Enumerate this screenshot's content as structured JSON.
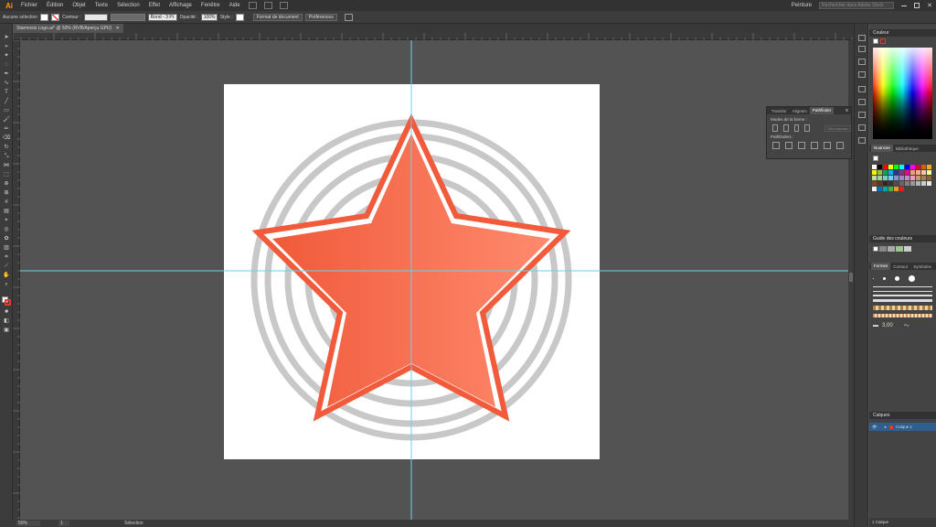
{
  "menubar": {
    "logo": "Ai",
    "menus": [
      "Fichier",
      "Édition",
      "Objet",
      "Texte",
      "Sélection",
      "Effet",
      "Affichage",
      "Fenêtre",
      "Aide"
    ],
    "workspace": "Peinture",
    "search_placeholder": "Rechercher dans Adobe Stock"
  },
  "control": {
    "selection_label": "Aucune sélection",
    "contour_label": "Contour :",
    "brush_value": "Rond - 3 Pt",
    "opacity_label": "Opacité :",
    "opacity_value": "100%",
    "style_label": "Style :",
    "doc_format_button": "Format de document",
    "prefs_button": "Préférences"
  },
  "document": {
    "tab_title": "Starmosis Logo.ai* @ 50% (RVB/Aperçu GPU)"
  },
  "status": {
    "zoom": "50%",
    "artboard": "1",
    "tool": "Sélection"
  },
  "pathfinder": {
    "tabs": [
      "Transfor",
      "Alignem",
      "Pathfinder"
    ],
    "active_tab": "Pathfinder",
    "shape_modes_label": "Modes de la forme :",
    "expand_button": "Décomposer",
    "pathfinders_label": "Pathfinders :"
  },
  "color_panel": {
    "title": "Couleur"
  },
  "swatches_panel": {
    "tabs": [
      "Nuancier",
      "Bibliothèque"
    ],
    "colors": [
      "#ffffff",
      "#000000",
      "#ff0000",
      "#ffff00",
      "#00ff00",
      "#00ffff",
      "#0000ff",
      "#ff00ff",
      "#c8102e",
      "#e05a00",
      "#f5a623",
      "#fff200",
      "#8dc63f",
      "#00a651",
      "#00aeef",
      "#2e3192",
      "#92278f",
      "#ec008c",
      "#f7977a",
      "#fbad82",
      "#fdc68a",
      "#fff799",
      "#c4df9b",
      "#a3d39c",
      "#7accc8",
      "#6dcff6",
      "#8493ca",
      "#a187be",
      "#bc8dbf",
      "#f49ac1",
      "#c69c6d",
      "#a67c52",
      "#8c6239",
      "#754c24",
      "#603913",
      "#3c2415",
      "#333333",
      "#4d4d4d",
      "#666666",
      "#808080",
      "#999999",
      "#b3b3b3",
      "#cccccc",
      "#e6e6e6",
      "#f2f2f2",
      "#0072bc",
      "#00a99d",
      "#39b54a",
      "#f7941d",
      "#ed1c24"
    ]
  },
  "color_guide_panel": {
    "title": "Guide des couleurs"
  },
  "brushes_panel": {
    "tabs": [
      "Formes",
      "Contour",
      "Symboles"
    ],
    "stroke_value": "3,00"
  },
  "layers_panel": {
    "title": "Calques",
    "layer_name": "Calque 1",
    "footer": "1 Calque"
  },
  "artwork": {
    "star_gradient_start": "#f05a3a",
    "star_gradient_end": "#ff8a6e",
    "ring_color": "#c8c8c8",
    "guide_color": "#69d3e8"
  }
}
